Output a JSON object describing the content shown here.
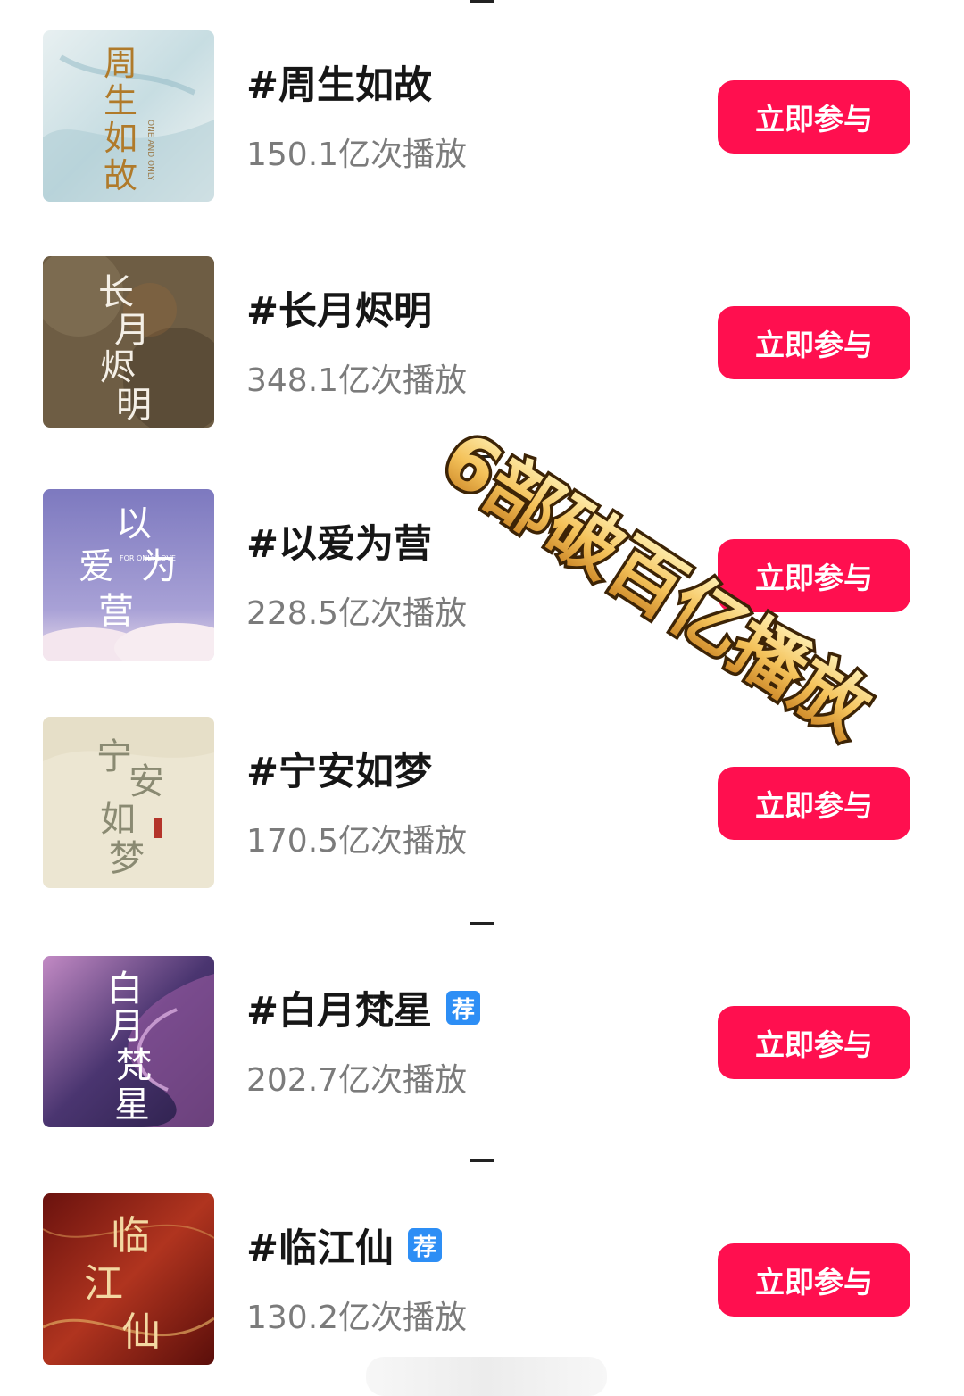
{
  "overlay": {
    "text": "6部破百亿播放"
  },
  "items": [
    {
      "title": "#周生如故",
      "plays": "150.1亿次播放",
      "button": "立即参与",
      "badge": null,
      "cover": {
        "calligraphy": "周生如故",
        "caption": "ONE AND ONLY",
        "palette": [
          "#dfe9ec",
          "#9cc0cc"
        ],
        "ink": "#b07a2a"
      }
    },
    {
      "title": "#长月烬明",
      "plays": "348.1亿次播放",
      "button": "立即参与",
      "badge": null,
      "cover": {
        "calligraphy": "长月烬明",
        "caption": "",
        "palette": [
          "#7f6d51",
          "#5b4c35"
        ],
        "ink": "#f4efe6"
      }
    },
    {
      "title": "#以爱为营",
      "plays": "228.5亿次播放",
      "button": "立即参与",
      "badge": null,
      "cover": {
        "calligraphy": "以爱为营",
        "caption": "FOR ONLY LOVE",
        "palette": [
          "#8a86c6",
          "#c6bde0"
        ],
        "ink": "#ffffff"
      }
    },
    {
      "title": "#宁安如梦",
      "plays": "170.5亿次播放",
      "button": "立即参与",
      "badge": null,
      "cover": {
        "calligraphy": "宁安如梦",
        "caption": "",
        "palette": [
          "#ece6d4",
          "#d8d0b6"
        ],
        "ink": "#8a8a72"
      }
    },
    {
      "title": "#白月梵星",
      "plays": "202.7亿次播放",
      "button": "立即参与",
      "badge": "荐",
      "cover": {
        "calligraphy": "白月梵星",
        "caption": "",
        "palette": [
          "#3a2a5c",
          "#b078b8"
        ],
        "ink": "#ffffff"
      }
    },
    {
      "title": "#临江仙",
      "plays": "130.2亿次播放",
      "button": "立即参与",
      "badge": "荐",
      "cover": {
        "calligraphy": "临江仙",
        "caption": "",
        "palette": [
          "#8c1a14",
          "#c2422a"
        ],
        "ink": "#f3d8a2"
      }
    }
  ],
  "colors": {
    "button": "#ff0f4f",
    "badge": "#2d8ef5",
    "plays_text": "#7b7b7b",
    "title_text": "#161616"
  }
}
